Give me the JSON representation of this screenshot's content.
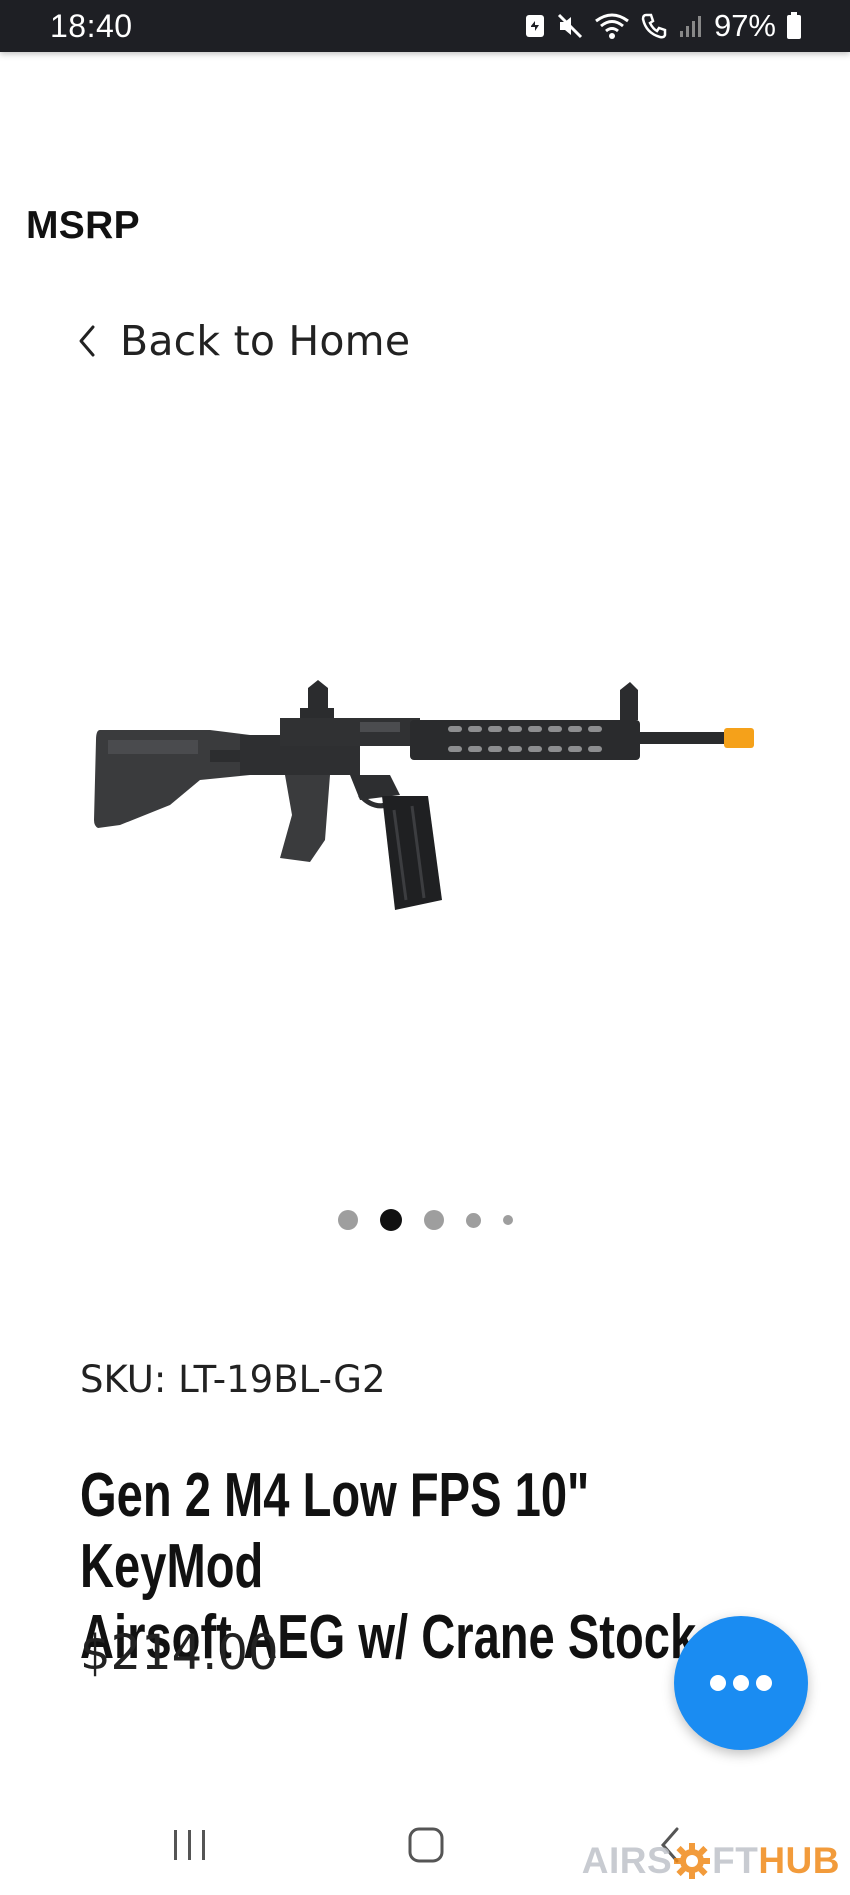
{
  "status_bar": {
    "time": "18:40",
    "battery_percent": "97%"
  },
  "brand": "MSRP",
  "back_link": {
    "label": "Back to Home"
  },
  "product_image": {
    "description_icon": "airsoft-rifle-image"
  },
  "carousel": {
    "count": 5,
    "active_index": 2
  },
  "product": {
    "sku": "SKU: LT-19BL-G2",
    "title_line1": "Gen 2 M4 Low FPS 10\" KeyMod",
    "title_line2": "Airsoft AEG w/ Crane Stock",
    "price": "$214.00"
  },
  "chat_button": {
    "icon": "more-dots-icon",
    "color": "#1a8cf2"
  },
  "nav_bar": {
    "recents_icon": "recents-icon",
    "home_icon": "home-icon",
    "back_icon": "back-icon"
  },
  "watermark": {
    "part1": "AIRS",
    "part2": "FT",
    "part3": "HUB"
  }
}
